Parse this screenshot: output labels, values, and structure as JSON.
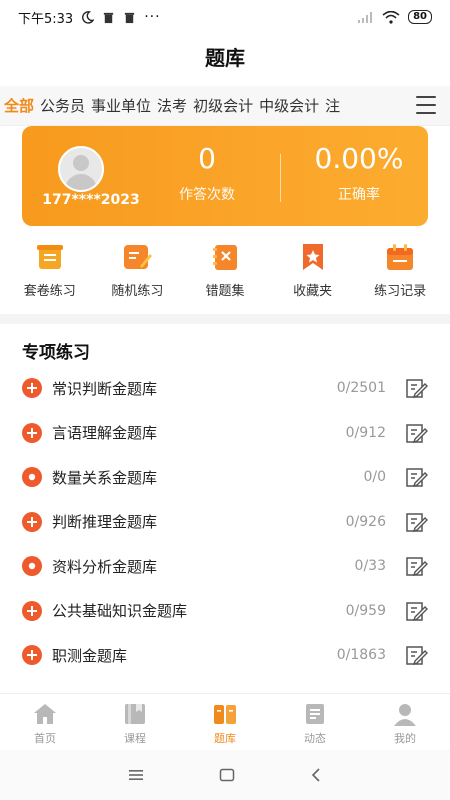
{
  "status_bar": {
    "time": "下午5:33",
    "battery": "80"
  },
  "header": {
    "title": "题库"
  },
  "category_tabs": [
    {
      "label": "全部",
      "active": true
    },
    {
      "label": "公务员",
      "active": false
    },
    {
      "label": "事业单位",
      "active": false
    },
    {
      "label": "法考",
      "active": false
    },
    {
      "label": "初级会计",
      "active": false
    },
    {
      "label": "中级会计",
      "active": false
    },
    {
      "label": "注",
      "active": false
    }
  ],
  "stats_card": {
    "username": "177****2023",
    "answer_count": "0",
    "answer_count_label": "作答次数",
    "accuracy": "0.00%",
    "accuracy_label": "正确率",
    "colors": {
      "start": "#f79a1e",
      "end": "#fbac2f"
    }
  },
  "quick_actions": [
    {
      "label": "套卷练习",
      "icon": "scroll-list-icon"
    },
    {
      "label": "随机练习",
      "icon": "edit-note-icon"
    },
    {
      "label": "错题集",
      "icon": "wrong-book-icon"
    },
    {
      "label": "收藏夹",
      "icon": "bookmark-star-icon"
    },
    {
      "label": "练习记录",
      "icon": "calendar-record-icon"
    }
  ],
  "section": {
    "title": "专项练习",
    "items": [
      {
        "name": "常识判断金题库",
        "count": "0/2501",
        "icon": "plus"
      },
      {
        "name": "言语理解金题库",
        "count": "0/912",
        "icon": "plus"
      },
      {
        "name": "数量关系金题库",
        "count": "0/0",
        "icon": "dot"
      },
      {
        "name": "判断推理金题库",
        "count": "0/926",
        "icon": "plus"
      },
      {
        "name": "资料分析金题库",
        "count": "0/33",
        "icon": "dot"
      },
      {
        "name": "公共基础知识金题库",
        "count": "0/959",
        "icon": "plus"
      },
      {
        "name": "职测金题库",
        "count": "0/1863",
        "icon": "plus"
      }
    ]
  },
  "bottom_nav": [
    {
      "label": "首页",
      "icon": "home-icon",
      "active": false
    },
    {
      "label": "课程",
      "icon": "course-icon",
      "active": false
    },
    {
      "label": "题库",
      "icon": "question-bank-icon",
      "active": true
    },
    {
      "label": "动态",
      "icon": "feed-icon",
      "active": false
    },
    {
      "label": "我的",
      "icon": "profile-icon",
      "active": false
    }
  ],
  "theme": {
    "accent": "#f08a1a",
    "row_icon": "#ef5a2d"
  }
}
